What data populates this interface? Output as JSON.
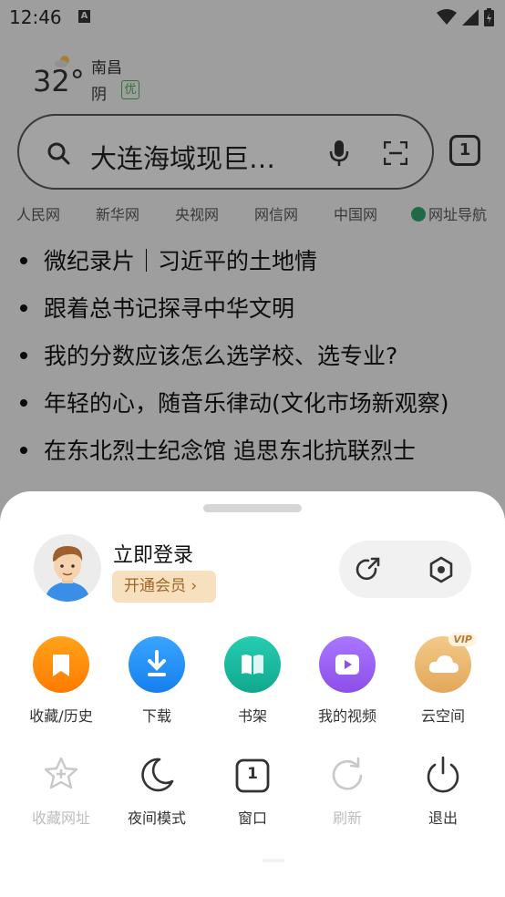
{
  "status_bar": {
    "time": "12:46",
    "notif_letter": "A"
  },
  "weather": {
    "temperature": "32°",
    "city": "南昌",
    "condition": "阴",
    "aqi": "优"
  },
  "search": {
    "query": "大连海域现巨…",
    "tab_count": "1"
  },
  "quick_links": [
    "人民网",
    "新华网",
    "央视网",
    "网信网",
    "中国网",
    "网址导航"
  ],
  "news": [
    "微纪录片｜习近平的土地情",
    "跟着总书记探寻中华文明",
    "我的分数应该怎么选学校、选专业?",
    "年轻的心，随音乐律动(文化市场新观察)",
    "在东北烈士纪念馆 追思东北抗联烈士"
  ],
  "menu": {
    "login_label": "立即登录",
    "vip_label": "开通会员",
    "grid": [
      {
        "label": "收藏/历史",
        "icon": "bookmark-icon",
        "color": "#ff8a00"
      },
      {
        "label": "下载",
        "icon": "download-icon",
        "color": "#1e90f5"
      },
      {
        "label": "书架",
        "icon": "book-icon",
        "color": "#19b9a0"
      },
      {
        "label": "我的视频",
        "icon": "video-icon",
        "color": "#9b5cf0"
      },
      {
        "label": "云空间",
        "icon": "cloud-icon",
        "color": "#e9b56a",
        "badge": "VIP"
      }
    ],
    "tools": [
      {
        "label": "收藏网址",
        "icon": "star-plus-icon",
        "disabled": true
      },
      {
        "label": "夜间模式",
        "icon": "moon-icon",
        "disabled": false
      },
      {
        "label": "窗口",
        "icon": "window-icon",
        "disabled": false,
        "count": "1"
      },
      {
        "label": "刷新",
        "icon": "refresh-icon",
        "disabled": true
      },
      {
        "label": "退出",
        "icon": "power-icon",
        "disabled": false
      }
    ]
  }
}
